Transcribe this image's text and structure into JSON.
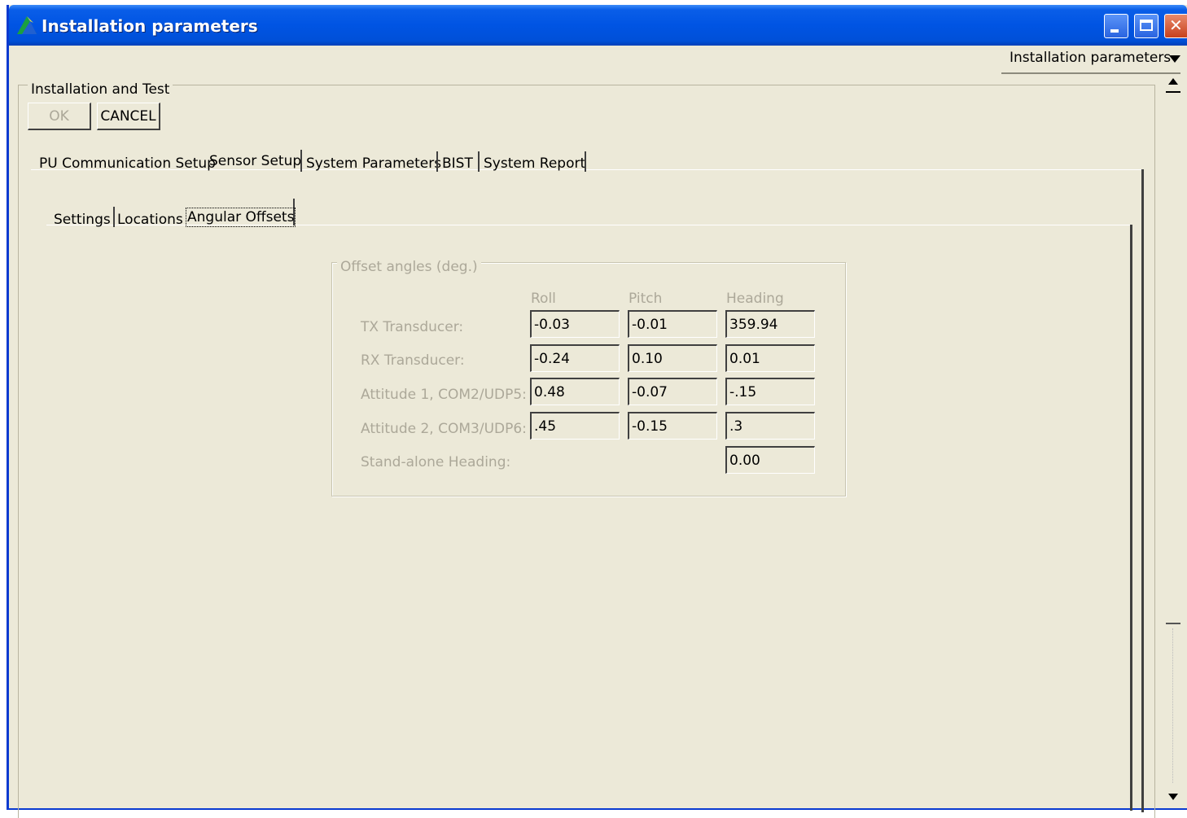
{
  "window": {
    "title": "Installation parameters"
  },
  "top_combo": {
    "selected": "Installation parameters"
  },
  "group": {
    "legend": "Installation and Test"
  },
  "buttons": {
    "ok": "OK",
    "cancel": "CANCEL"
  },
  "main_tabs": [
    {
      "label": "PU Communication Setup"
    },
    {
      "label": "Sensor Setup",
      "active": true
    },
    {
      "label": "System Parameters"
    },
    {
      "label": "BIST"
    },
    {
      "label": "System Report"
    }
  ],
  "sub_tabs": [
    {
      "label": "Settings"
    },
    {
      "label": "Locations"
    },
    {
      "label": "Angular Offsets",
      "active": true
    }
  ],
  "offsets": {
    "legend": "Offset angles (deg.)",
    "columns": [
      "Roll",
      "Pitch",
      "Heading"
    ],
    "rows": [
      {
        "label": "TX Transducer:",
        "roll": "-0.03",
        "pitch": "-0.01",
        "heading": "359.94"
      },
      {
        "label": "RX Transducer:",
        "roll": "-0.24",
        "pitch": "0.10",
        "heading": "0.01"
      },
      {
        "label": "Attitude 1, COM2/UDP5:",
        "roll": "0.48",
        "pitch": "-0.07",
        "heading": "-.15"
      },
      {
        "label": "Attitude 2, COM3/UDP6:",
        "roll": ".45",
        "pitch": "-0.15",
        "heading": ".3"
      },
      {
        "label": "Stand-alone Heading:",
        "heading": "0.00"
      }
    ]
  },
  "colors": {
    "titlebar": "#0054e3",
    "window_bg": "#ece9d8",
    "disabled_text": "#aca899"
  }
}
